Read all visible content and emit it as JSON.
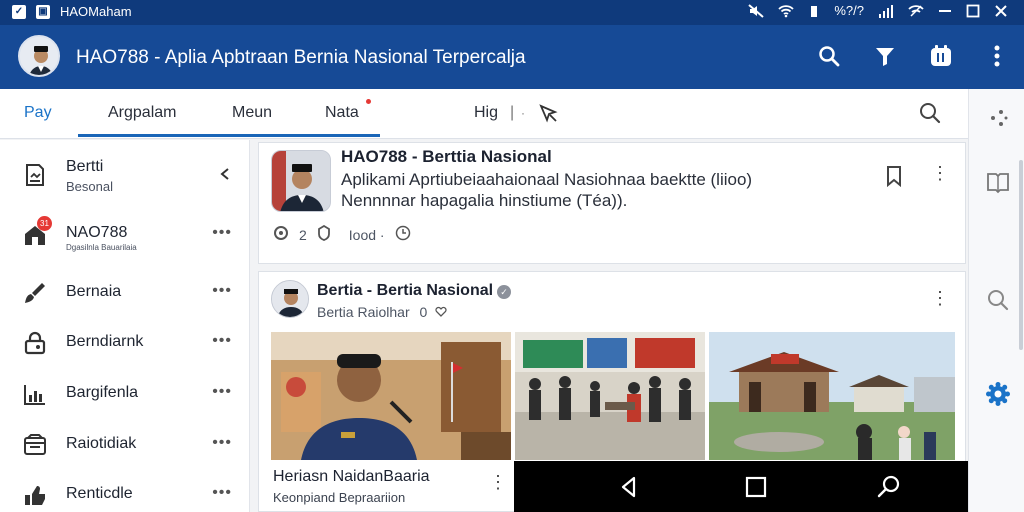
{
  "statusbar": {
    "app_label": "HAOMaham",
    "signal_text": "%?/?"
  },
  "appbar": {
    "title": "HAO788 - Aplia  Apbtraan Bernia Nasional Terpercalja",
    "actions": [
      "search-icon",
      "filter-icon",
      "calendar-icon",
      "more-vertical-icon"
    ]
  },
  "tabs": [
    {
      "label": "Pay"
    },
    {
      "label": "Argpalam"
    },
    {
      "label": "Meun"
    },
    {
      "label": "Nata"
    },
    {
      "label": "Hig"
    }
  ],
  "sidebar": {
    "items": [
      {
        "label": "Bertti",
        "sub": "Besonal",
        "icon": "bookmark-page-icon",
        "action": "chevron-left-icon"
      },
      {
        "label": "NAO788",
        "sub": "Dgasilnla Bauarilaia",
        "icon": "home-icon",
        "badge": "31",
        "action": "more-icon"
      },
      {
        "label": "Bernaia",
        "icon": "brush-icon",
        "action": "more-icon"
      },
      {
        "label": "Berndiarnk",
        "icon": "lock-icon",
        "action": "more-icon"
      },
      {
        "label": "Bargifenla",
        "icon": "chart-icon",
        "action": "more-icon"
      },
      {
        "label": "Raiotidiak",
        "icon": "inbox-icon",
        "action": "more-icon"
      },
      {
        "label": "Renticdle",
        "icon": "thumb-icon",
        "action": "more-icon"
      }
    ]
  },
  "post1": {
    "title": "HAO788 - Berttia Nasional",
    "line1": "Aplikami Aprtiubeiaahaionaal Nasiohnaa baektte (liioo)",
    "line2": "Nennnnar hapagalia hinstiume (Téa)).",
    "reactions_count": "2",
    "time_label": "Iood ·"
  },
  "post2": {
    "title": "Bertia - Bertia Nasional",
    "subtitle": "Bertia Raiolhar",
    "subtitle_count": "0",
    "caption": "Heriasn NaidanBaaria",
    "caption_sub": "Keonpiand Bepraariion"
  },
  "colors": {
    "primary": "#164a96",
    "statusbar": "#0f3a7c",
    "accent": "#1a73c8",
    "badge": "#e53935"
  }
}
